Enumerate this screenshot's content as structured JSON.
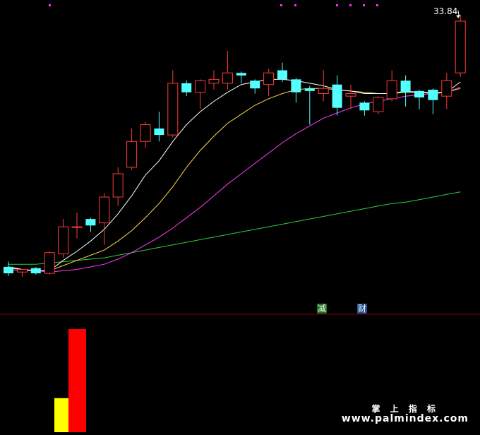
{
  "chart_data": {
    "type": "candlestick",
    "last_price_label": "33.84",
    "ylim": [
      12.5,
      35.0
    ],
    "colors": {
      "up": "#ff3b3b",
      "down": "#54ffff",
      "ma5": "#ffffff",
      "ma10": "#ffd84a",
      "ma20": "#ff3bff",
      "ma60": "#2ecc40",
      "volume_yellow": "#ffff00",
      "volume_red": "#ff0000",
      "divider": "#8b0000"
    },
    "candles": [
      {
        "o": 14.8,
        "h": 15.2,
        "l": 14.1,
        "c": 14.3
      },
      {
        "o": 14.4,
        "h": 14.6,
        "l": 14.0,
        "c": 14.6
      },
      {
        "o": 14.7,
        "h": 14.8,
        "l": 14.2,
        "c": 14.3
      },
      {
        "o": 14.3,
        "h": 16.0,
        "l": 14.2,
        "c": 15.9
      },
      {
        "o": 15.8,
        "h": 18.5,
        "l": 15.5,
        "c": 17.9
      },
      {
        "o": 17.9,
        "h": 19.0,
        "l": 17.0,
        "c": 17.9
      },
      {
        "o": 18.5,
        "h": 18.6,
        "l": 17.5,
        "c": 18.0
      },
      {
        "o": 18.2,
        "h": 20.5,
        "l": 16.5,
        "c": 20.2
      },
      {
        "o": 20.2,
        "h": 22.5,
        "l": 19.5,
        "c": 22.0
      },
      {
        "o": 22.5,
        "h": 25.5,
        "l": 22.3,
        "c": 24.5
      },
      {
        "o": 24.5,
        "h": 26.0,
        "l": 24.0,
        "c": 25.8
      },
      {
        "o": 25.5,
        "h": 26.8,
        "l": 24.5,
        "c": 25.0
      },
      {
        "o": 25.0,
        "h": 30.0,
        "l": 24.8,
        "c": 29.0
      },
      {
        "o": 29.0,
        "h": 29.2,
        "l": 28.0,
        "c": 28.3
      },
      {
        "o": 28.3,
        "h": 29.3,
        "l": 27.0,
        "c": 29.2
      },
      {
        "o": 29.0,
        "h": 30.0,
        "l": 28.5,
        "c": 29.3
      },
      {
        "o": 29.0,
        "h": 31.5,
        "l": 28.5,
        "c": 29.8
      },
      {
        "o": 29.8,
        "h": 29.9,
        "l": 29.0,
        "c": 29.6
      },
      {
        "o": 29.2,
        "h": 29.3,
        "l": 28.2,
        "c": 28.6
      },
      {
        "o": 28.9,
        "h": 30.1,
        "l": 28.0,
        "c": 29.8
      },
      {
        "o": 30.0,
        "h": 30.6,
        "l": 29.1,
        "c": 29.3
      },
      {
        "o": 29.3,
        "h": 29.4,
        "l": 27.5,
        "c": 28.3
      },
      {
        "o": 28.6,
        "h": 28.8,
        "l": 25.8,
        "c": 28.4
      },
      {
        "o": 28.2,
        "h": 30.0,
        "l": 27.6,
        "c": 28.6
      },
      {
        "o": 28.9,
        "h": 29.6,
        "l": 26.5,
        "c": 27.1
      },
      {
        "o": 28.0,
        "h": 28.9,
        "l": 27.0,
        "c": 28.2
      },
      {
        "o": 27.5,
        "h": 27.6,
        "l": 26.5,
        "c": 26.9
      },
      {
        "o": 26.8,
        "h": 28.0,
        "l": 26.6,
        "c": 27.9
      },
      {
        "o": 27.8,
        "h": 30.0,
        "l": 27.6,
        "c": 29.2
      },
      {
        "o": 29.2,
        "h": 29.6,
        "l": 27.2,
        "c": 28.3
      },
      {
        "o": 28.4,
        "h": 28.5,
        "l": 27.0,
        "c": 27.9
      },
      {
        "o": 28.5,
        "h": 28.6,
        "l": 26.6,
        "c": 27.7
      },
      {
        "o": 28.0,
        "h": 29.8,
        "l": 27.0,
        "c": 29.2
      },
      {
        "o": 29.8,
        "h": 34.3,
        "l": 29.5,
        "c": 33.8
      }
    ],
    "ma5": [
      14.8,
      14.6,
      14.5,
      14.5,
      15.3,
      16.0,
      16.8,
      17.7,
      18.9,
      20.3,
      21.9,
      23.0,
      24.5,
      25.8,
      26.8,
      27.6,
      28.3,
      28.9,
      29.1,
      29.3,
      29.3,
      29.2,
      29.0,
      28.8,
      28.5,
      28.4,
      28.2,
      28.2,
      28.2,
      28.4,
      28.3,
      28.2,
      28.3,
      29.1
    ],
    "ma10": [
      14.7,
      14.6,
      14.5,
      14.5,
      14.9,
      15.3,
      15.7,
      16.1,
      16.8,
      17.6,
      18.6,
      19.7,
      21.0,
      22.5,
      23.8,
      24.9,
      25.9,
      26.6,
      27.3,
      27.8,
      28.2,
      28.5,
      28.6,
      28.6,
      28.5,
      28.4,
      28.3,
      28.2,
      28.2,
      28.3,
      28.3,
      28.3,
      28.3,
      28.6
    ],
    "ma20": [
      14.6,
      14.5,
      14.5,
      14.4,
      14.5,
      14.6,
      14.8,
      15.0,
      15.4,
      15.9,
      16.5,
      17.1,
      17.8,
      18.6,
      19.4,
      20.3,
      21.2,
      22.0,
      22.8,
      23.6,
      24.4,
      25.1,
      25.7,
      26.3,
      26.7,
      27.1,
      27.4,
      27.6,
      27.8,
      28.0,
      28.1,
      28.2,
      28.3,
      28.7
    ],
    "ma60": [
      15.0,
      15.0,
      15.0,
      15.1,
      15.2,
      15.3,
      15.4,
      15.5,
      15.7,
      15.9,
      16.1,
      16.3,
      16.5,
      16.7,
      16.9,
      17.1,
      17.3,
      17.5,
      17.7,
      17.9,
      18.1,
      18.3,
      18.5,
      18.7,
      18.9,
      19.1,
      19.3,
      19.5,
      19.7,
      19.8,
      20.0,
      20.2,
      20.4,
      20.6
    ],
    "volume": {
      "bars": [
        {
          "index": 4,
          "value": 0.33,
          "color": "yellow"
        },
        {
          "index": 5,
          "value": 1.0,
          "color": "red"
        }
      ]
    },
    "signals": [
      {
        "label": "减"
      },
      {
        "label": "财"
      }
    ],
    "grid": false
  },
  "watermark": {
    "line1": "掌 上 指 标",
    "line2": "www.palmindex.com"
  }
}
